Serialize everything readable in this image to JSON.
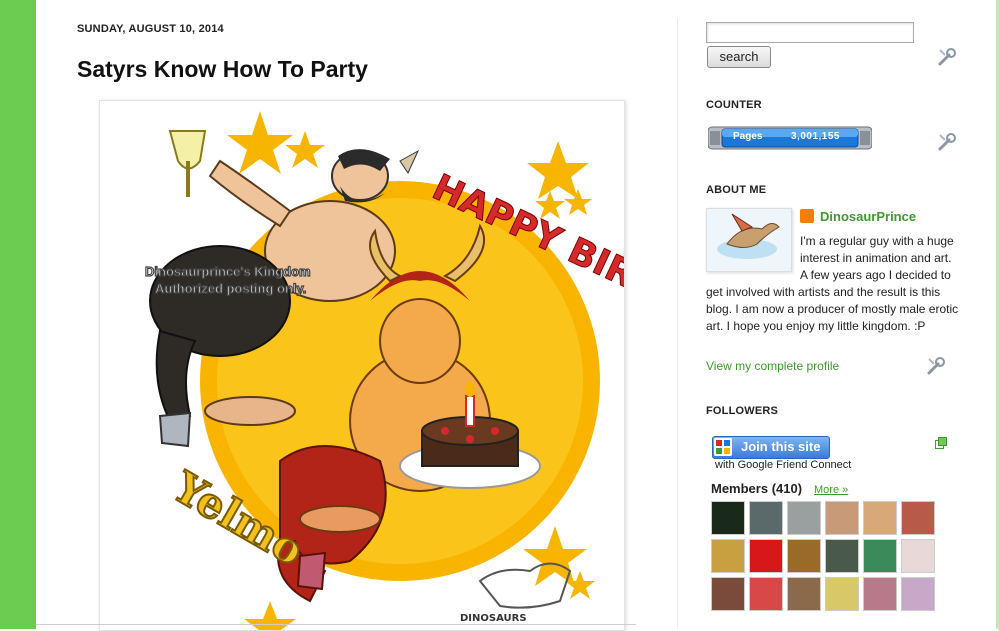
{
  "post": {
    "date": "SUNDAY, AUGUST 10, 2014",
    "title": "Satyrs Know How To Party",
    "image": {
      "banner": "HAPPY BIRTHDAY",
      "name": "Yelmo",
      "watermark_line1": "Dinosaurprince's Kingdom",
      "watermark_line2": "Authorized posting only.",
      "logo_text": "DINOSAURS"
    }
  },
  "sidebar": {
    "search": {
      "value": "",
      "button_label": "search"
    },
    "counter": {
      "title": "COUNTER",
      "label": "Pages",
      "value": "3,001,155"
    },
    "about": {
      "title": "ABOUT ME",
      "name": "DinosaurPrince",
      "text_line1": "I'm a regular guy with a huge",
      "text_line2": "interest in animation and art.",
      "text_line3": "A few years ago I decided to",
      "text_rest": "get involved with artists and the result is this blog. I am now a producer of mostly male erotic art. I hope you enjoy my little kingdom. :P",
      "profile_link": "View my complete profile"
    },
    "followers": {
      "title": "FOLLOWERS",
      "join_label": "Join this site",
      "subtitle": "with Google Friend Connect",
      "members_label": "Members (410)",
      "more_label": "More »"
    }
  },
  "colors": {
    "accent_green": "#6ccc52",
    "link_green": "#3d9a2d",
    "blogger_orange": "#f57d00"
  },
  "icons": {
    "wrench": "wrench-icon",
    "blogger": "blogger-icon",
    "expand": "expand-icon"
  }
}
